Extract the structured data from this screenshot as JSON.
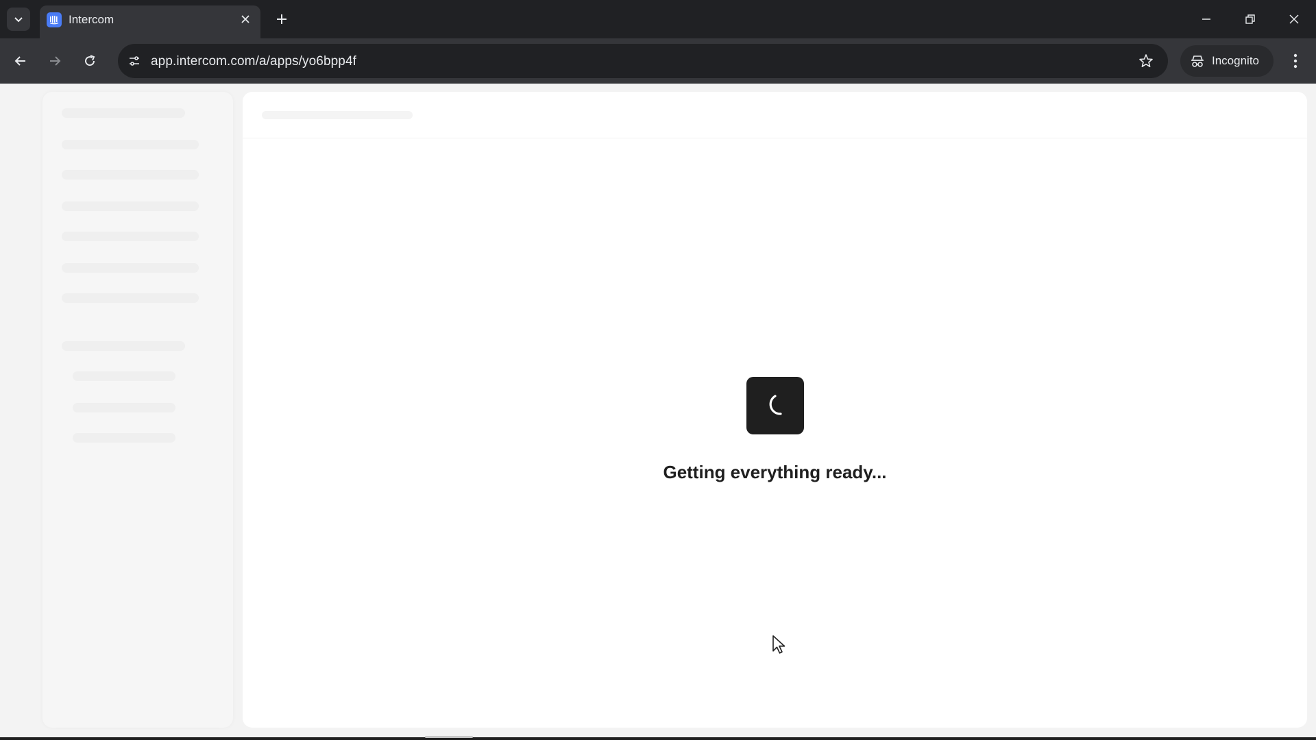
{
  "browser": {
    "tab": {
      "title": "Intercom",
      "favicon": "intercom-logo-icon"
    },
    "address_bar": {
      "url": "app.intercom.com/a/apps/yo6bpp4f"
    },
    "profile": {
      "label": "Incognito",
      "icon": "incognito-icon"
    },
    "colors": {
      "tabstrip": "#202124",
      "toolbar": "#35363a",
      "favicon_accent": "#4a7cf6"
    }
  },
  "page": {
    "loading_message": "Getting everything ready...",
    "loader_icon": "spinner-icon",
    "colors": {
      "background": "#f3f3f3",
      "card": "#ffffff",
      "loader": "#1f1f1f"
    }
  }
}
